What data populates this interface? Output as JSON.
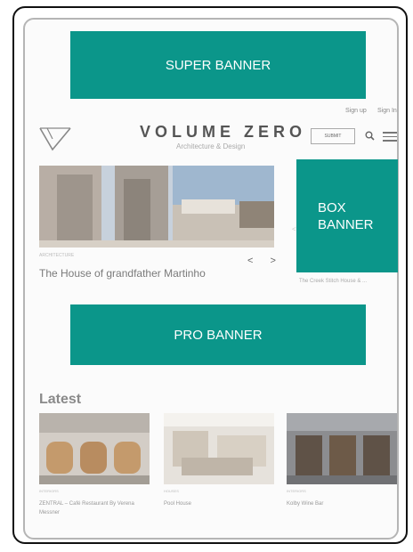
{
  "banners": {
    "super": "SUPER BANNER",
    "box_line1": "BOX",
    "box_line2": "BANNER",
    "pro": "PRO BANNER"
  },
  "header": {
    "sign_up": "Sign up",
    "sign_in": "Sign In",
    "brand": "VOLUME ZERO",
    "tagline": "Architecture & Design",
    "submit": "SUBMIT",
    "accent": "#0b968a"
  },
  "featured": {
    "category": "ARCHITECTURE",
    "title": "The House of grandfather Martinho",
    "arrows": "< >",
    "side_prev": "<",
    "side_title": "The Creek Stitch House & ..."
  },
  "latest": {
    "heading": "Latest",
    "cards": [
      {
        "category": "INTERIORS",
        "title": "ZENTRAL – Café Restaurant By Verena Messner"
      },
      {
        "category": "HOUSES",
        "title": "Pool House"
      },
      {
        "category": "INTERIORS",
        "title": "Kolby Wine Bar"
      }
    ]
  }
}
